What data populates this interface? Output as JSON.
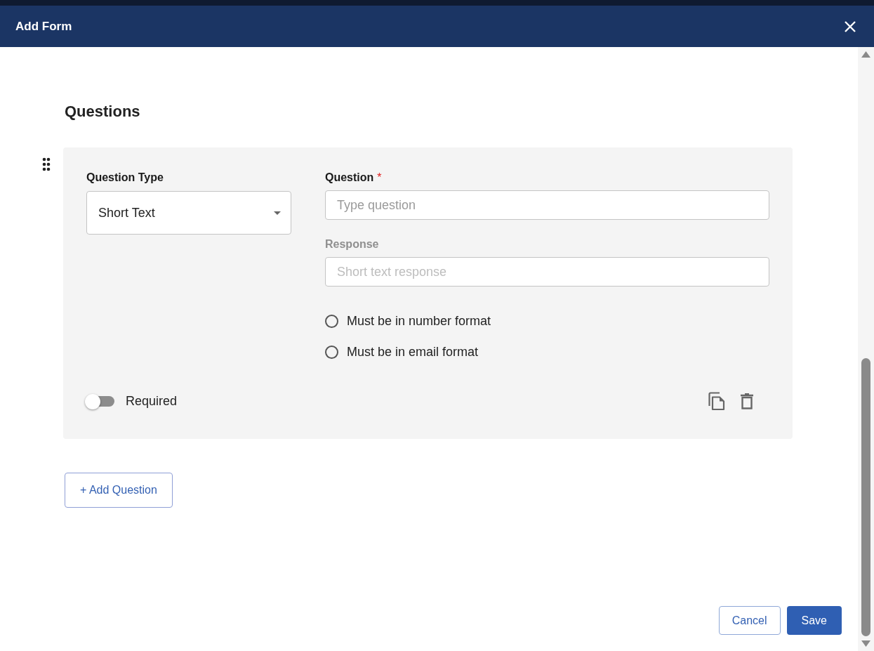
{
  "dialog": {
    "title": "Add Form"
  },
  "section_title": "Questions",
  "questions": [
    {
      "type_label": "Question Type",
      "type_value": "Short Text",
      "question_label": "Question",
      "required_mark": "*",
      "question_placeholder": "Type question",
      "response": {
        "label": "Response",
        "placeholder": "Short text response",
        "disabled": true
      },
      "options": [
        {
          "label": "Must be in number format",
          "selected": false
        },
        {
          "label": "Must be in email format",
          "selected": false
        }
      ],
      "required": {
        "label": "Required",
        "on": false
      }
    }
  ],
  "add_button": "+ Add Question",
  "buttons": [
    {
      "label": "Cancel",
      "kind": "secondary"
    },
    {
      "label": "Save",
      "kind": "primary"
    }
  ]
}
